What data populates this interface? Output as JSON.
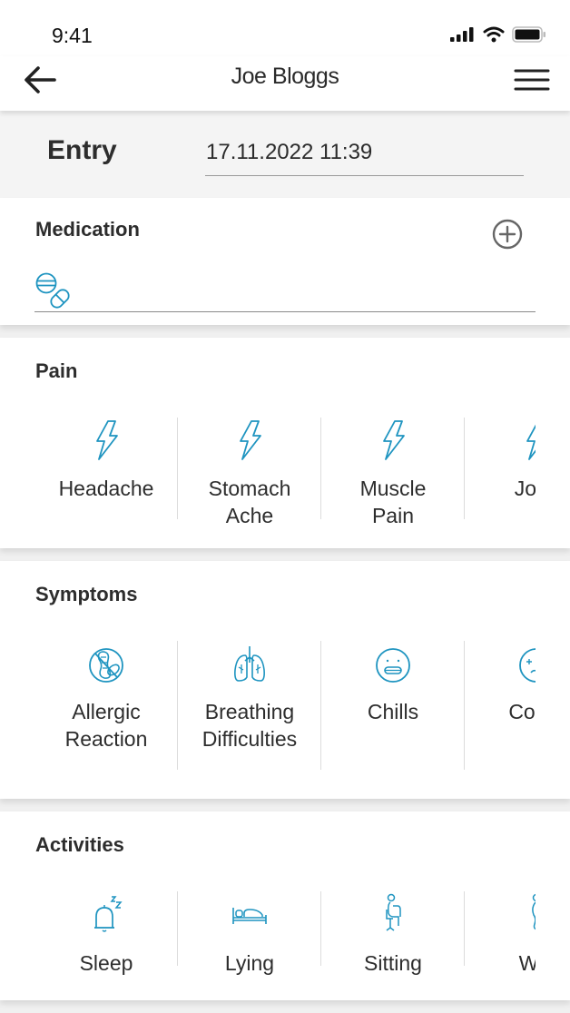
{
  "status_bar": {
    "time": "9:41",
    "icons": [
      "signal-icon",
      "wifi-icon",
      "battery-icon"
    ]
  },
  "app_bar": {
    "title": "Joe Bloggs",
    "back_icon": "arrow-left-icon",
    "menu_icon": "hamburger-menu-icon"
  },
  "entry": {
    "label": "Entry",
    "datetime_value": "17.11.2022 11:39"
  },
  "medication": {
    "title": "Medication",
    "add_icon": "plus-circle-icon",
    "field_icon": "pills-icon",
    "field_value": ""
  },
  "pain": {
    "title": "Pain",
    "items": [
      {
        "label": "Headache",
        "icon": "lightning-bolt-icon"
      },
      {
        "label": "Stomach\nAche",
        "icon": "lightning-bolt-icon"
      },
      {
        "label": "Muscle\nPain",
        "icon": "lightning-bolt-icon"
      },
      {
        "label": "Joint",
        "icon": "lightning-bolt-icon"
      }
    ]
  },
  "symptoms": {
    "title": "Symptoms",
    "items": [
      {
        "label": "Allergic\nReaction",
        "icon": "allergy-peanut-icon"
      },
      {
        "label": "Breathing\nDifficulties",
        "icon": "lungs-icon"
      },
      {
        "label": "Chills",
        "icon": "chattering-face-icon"
      },
      {
        "label": "Confu",
        "icon": "confused-face-icon"
      }
    ]
  },
  "activities": {
    "title": "Activities",
    "items": [
      {
        "label": "Sleep",
        "icon": "bell-zzz-icon"
      },
      {
        "label": "Lying",
        "icon": "bed-icon"
      },
      {
        "label": "Sitting",
        "icon": "sitting-person-icon"
      },
      {
        "label": "Wal",
        "icon": "walking-person-icon"
      }
    ]
  },
  "colors": {
    "icon_accent": "#1e94c0",
    "text": "#2d2d2d",
    "entry_bg": "#f4f4f4",
    "divider": "#dcdcdc"
  }
}
